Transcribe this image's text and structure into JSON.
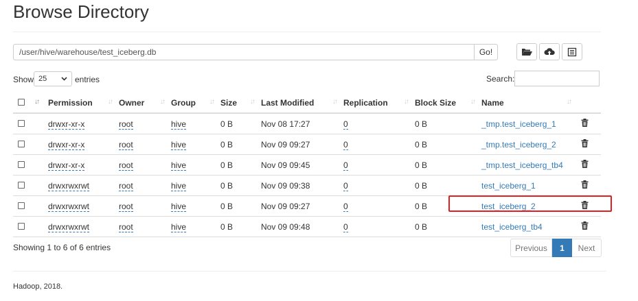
{
  "page_title": "Browse Directory",
  "path": {
    "value": "/user/hive/warehouse/test_iceberg.db",
    "go_label": "Go!"
  },
  "toolbar": {
    "icons": [
      "folder-open-icon",
      "cloud-upload-icon",
      "list-icon"
    ]
  },
  "length": {
    "show_label": "Show",
    "value": "25",
    "entries_label": "entries"
  },
  "search": {
    "label": "Search:"
  },
  "table": {
    "headers": {
      "permission": "Permission",
      "owner": "Owner",
      "group": "Group",
      "size": "Size",
      "last_modified": "Last Modified",
      "replication": "Replication",
      "block_size": "Block Size",
      "name": "Name"
    },
    "rows": [
      {
        "permission": "drwxr-xr-x",
        "owner": "root",
        "group": "hive",
        "size": "0 B",
        "last_modified": "Nov 08 17:27",
        "replication": "0",
        "block_size": "0 B",
        "name": "_tmp.test_iceberg_1"
      },
      {
        "permission": "drwxr-xr-x",
        "owner": "root",
        "group": "hive",
        "size": "0 B",
        "last_modified": "Nov 09 09:27",
        "replication": "0",
        "block_size": "0 B",
        "name": "_tmp.test_iceberg_2"
      },
      {
        "permission": "drwxr-xr-x",
        "owner": "root",
        "group": "hive",
        "size": "0 B",
        "last_modified": "Nov 09 09:45",
        "replication": "0",
        "block_size": "0 B",
        "name": "_tmp.test_iceberg_tb4"
      },
      {
        "permission": "drwxrwxrwt",
        "owner": "root",
        "group": "hive",
        "size": "0 B",
        "last_modified": "Nov 09 09:38",
        "replication": "0",
        "block_size": "0 B",
        "name": "test_iceberg_1"
      },
      {
        "permission": "drwxrwxrwt",
        "owner": "root",
        "group": "hive",
        "size": "0 B",
        "last_modified": "Nov 09 09:27",
        "replication": "0",
        "block_size": "0 B",
        "name": "test_iceberg_2"
      },
      {
        "permission": "drwxrwxrwt",
        "owner": "root",
        "group": "hive",
        "size": "0 B",
        "last_modified": "Nov 09 09:48",
        "replication": "0",
        "block_size": "0 B",
        "name": "test_iceberg_tb4"
      }
    ]
  },
  "info": "Showing 1 to 6 of 6 entries",
  "pagination": {
    "previous": "Previous",
    "current": "1",
    "next": "Next"
  },
  "footer": "Hadoop, 2018.",
  "colors": {
    "link": "#337ab7",
    "highlight": "#e02020"
  }
}
